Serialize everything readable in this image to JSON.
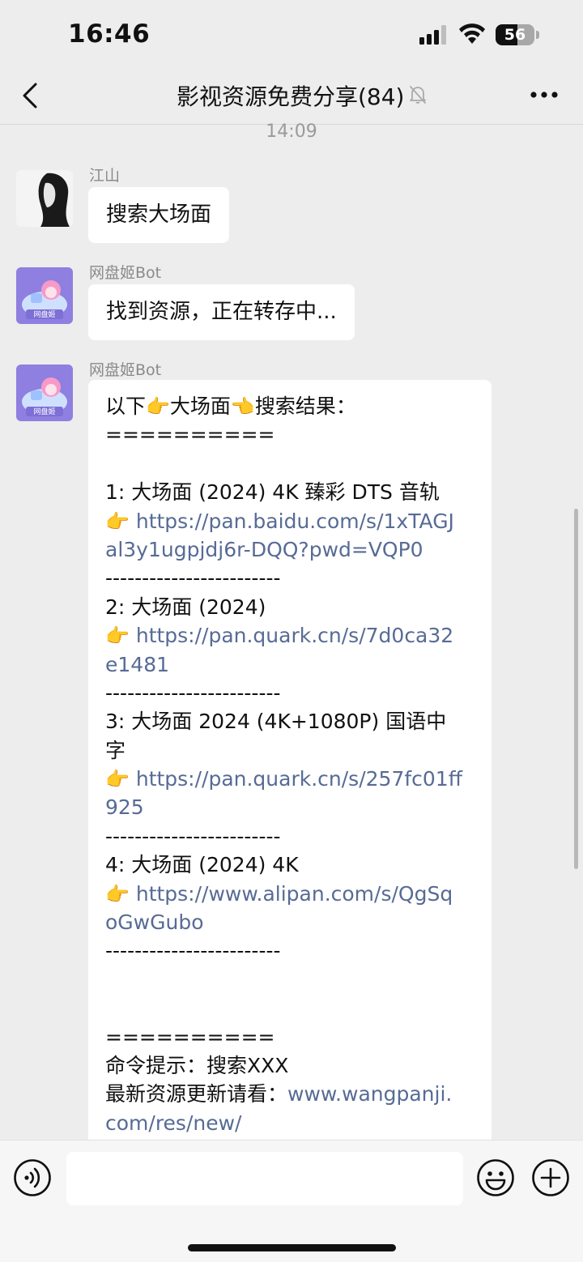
{
  "status_bar": {
    "time": "16:46",
    "battery_level": "56",
    "battery_fraction": 0.56
  },
  "nav": {
    "back_icon": "chevron-left-icon",
    "title": "影视资源免费分享(84)",
    "mute_icon": "bell-slash-icon",
    "more_icon": "ellipsis-icon"
  },
  "chat": {
    "timestamp": "14:09",
    "messages": [
      {
        "sender": "江山",
        "text": "搜索大场面"
      },
      {
        "sender": "网盘姬Bot",
        "text": "找到资源，正在转存中..."
      },
      {
        "sender": "网盘姬Bot",
        "lines": [
          {
            "parts": [
              {
                "t": "以下"
              },
              {
                "t": "👉",
                "emoji": true
              },
              {
                "t": "大场面"
              },
              {
                "t": "👈",
                "emoji": true
              },
              {
                "t": "搜索结果："
              }
            ]
          },
          {
            "parts": [
              {
                "t": "=========="
              }
            ]
          },
          {
            "parts": [
              {
                "t": ""
              }
            ]
          },
          {
            "parts": [
              {
                "t": "1: 大场面 (2024) 4K 臻彩 DTS 音轨"
              }
            ]
          },
          {
            "parts": [
              {
                "t": "👉",
                "emoji": true
              },
              {
                "t": " "
              },
              {
                "t": "https://pan.baidu.com/s/1xTAGJ",
                "link": true
              }
            ]
          },
          {
            "parts": [
              {
                "t": "al3y1ugpjdj6r-DQQ?pwd=VQP0",
                "link": true
              }
            ]
          },
          {
            "parts": [
              {
                "t": "------------------------"
              }
            ]
          },
          {
            "parts": [
              {
                "t": "2: 大场面 (2024)"
              }
            ]
          },
          {
            "parts": [
              {
                "t": "👉",
                "emoji": true
              },
              {
                "t": " "
              },
              {
                "t": "https://pan.quark.cn/s/7d0ca32",
                "link": true
              }
            ]
          },
          {
            "parts": [
              {
                "t": "e1481",
                "link": true
              }
            ]
          },
          {
            "parts": [
              {
                "t": "------------------------"
              }
            ]
          },
          {
            "parts": [
              {
                "t": "3: 大场面 2024 (4K+1080P) 国语中"
              }
            ]
          },
          {
            "parts": [
              {
                "t": "字"
              }
            ]
          },
          {
            "parts": [
              {
                "t": "👉",
                "emoji": true
              },
              {
                "t": " "
              },
              {
                "t": "https://pan.quark.cn/s/257fc01ff",
                "link": true
              }
            ]
          },
          {
            "parts": [
              {
                "t": "925",
                "link": true
              }
            ]
          },
          {
            "parts": [
              {
                "t": "------------------------"
              }
            ]
          },
          {
            "parts": [
              {
                "t": "4: 大场面 (2024) 4K"
              }
            ]
          },
          {
            "parts": [
              {
                "t": "👉",
                "emoji": true
              },
              {
                "t": " "
              },
              {
                "t": "https://www.alipan.com/s/QgSq",
                "link": true
              }
            ]
          },
          {
            "parts": [
              {
                "t": "oGwGubo",
                "link": true
              }
            ]
          },
          {
            "parts": [
              {
                "t": "------------------------"
              }
            ]
          },
          {
            "parts": [
              {
                "t": ""
              }
            ]
          },
          {
            "parts": [
              {
                "t": ""
              }
            ]
          },
          {
            "parts": [
              {
                "t": "=========="
              }
            ]
          },
          {
            "parts": [
              {
                "t": "命令提示：搜索XXX"
              }
            ]
          },
          {
            "parts": [
              {
                "t": "最新资源更新请看："
              },
              {
                "t": "www.wangpanji.",
                "link": true
              }
            ]
          },
          {
            "parts": [
              {
                "t": "com/res/new/",
                "link": true
              }
            ]
          }
        ]
      }
    ]
  },
  "input_bar": {
    "voice_icon": "voice-icon",
    "input_value": "",
    "emoji_icon": "smiley-icon",
    "add_icon": "plus-circle-icon"
  },
  "colors": {
    "background": "#ededed",
    "bubble": "#ffffff",
    "link": "#576b95",
    "muted_text": "#8a8a8a"
  }
}
